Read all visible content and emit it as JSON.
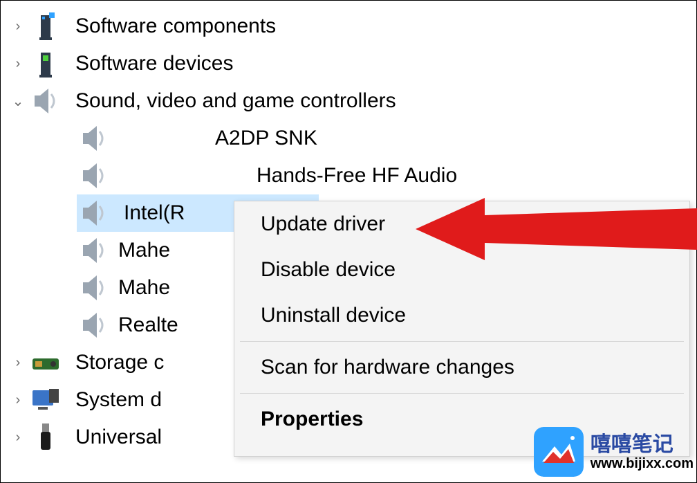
{
  "tree": {
    "software_components": {
      "label": "Software components",
      "expanded": false
    },
    "software_devices": {
      "label": "Software devices",
      "expanded": false
    },
    "sound_controllers": {
      "label": "Sound, video and game controllers",
      "expanded": true,
      "children": {
        "a2dp": {
          "label": "A2DP SNK"
        },
        "handsfree": {
          "label": "Hands-Free HF Audio"
        },
        "intel": {
          "label": "Intel(R"
        },
        "mahe1": {
          "label": "Mahe"
        },
        "mahe2": {
          "label": "Mahe"
        },
        "realte": {
          "label": "Realte"
        }
      }
    },
    "storage": {
      "label": "Storage c",
      "expanded": false
    },
    "system_devices": {
      "label": "System d",
      "expanded": false
    },
    "universal": {
      "label": "Universal",
      "expanded": false
    }
  },
  "context_menu": {
    "update_driver": "Update driver",
    "disable_device": "Disable device",
    "uninstall_device": "Uninstall device",
    "scan_hardware": "Scan for hardware changes",
    "properties": "Properties"
  },
  "watermark": {
    "name_cn": "嘻嘻笔记",
    "url": "www.bijixx.com"
  },
  "glyphs": {
    "collapsed": "›",
    "expanded": "⌄"
  }
}
